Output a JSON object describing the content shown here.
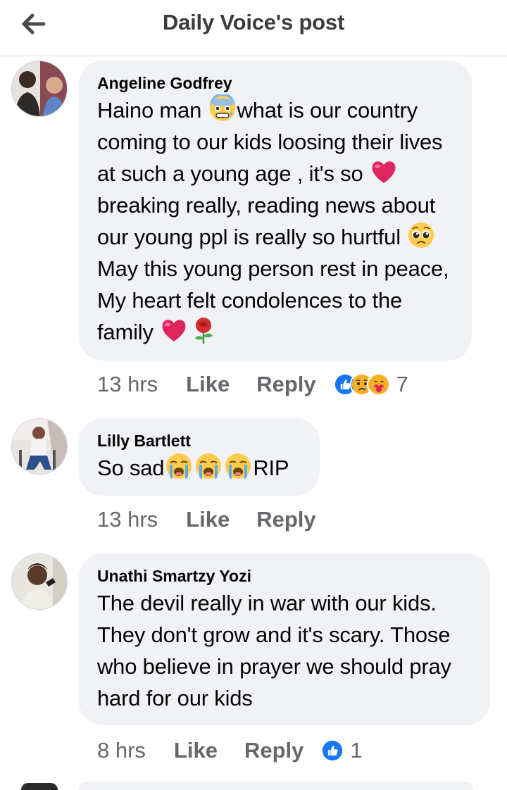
{
  "header": {
    "title": "Daily Voice's post"
  },
  "comments": [
    {
      "author": "Angeline Godfrey",
      "text_parts": [
        "Haino man ",
        "what is our country coming to our kids loosing their lives at such a young age , it's so ",
        " breaking really, reading news about our young ppl is really so hurtful ",
        "May this young person rest in peace, My heart felt condolences to the family "
      ],
      "emojis": [
        "anxious-face-emoji",
        "red-heart-emoji",
        "pleading-face-emoji",
        "red-heart-emoji",
        "rose-emoji"
      ],
      "time": "13 hrs",
      "like_label": "Like",
      "reply_label": "Reply",
      "reactions": [
        "like-reaction-icon",
        "sad-reaction-icon",
        "care-reaction-icon"
      ],
      "reaction_count": "7"
    },
    {
      "author": "Lilly Bartlett",
      "text_parts": [
        "So sad",
        "RIP"
      ],
      "emojis": [
        "loudly-crying-face-emoji",
        "loudly-crying-face-emoji",
        "loudly-crying-face-emoji"
      ],
      "time": "13 hrs",
      "like_label": "Like",
      "reply_label": "Reply"
    },
    {
      "author": "Unathi Smartzy Yozi",
      "text": "The devil really in war with our kids. They don't grow and it's scary. Those who believe in prayer we should pray hard for our kids",
      "time": "8 hrs",
      "like_label": "Like",
      "reply_label": "Reply",
      "reactions": [
        "like-reaction-icon"
      ],
      "reaction_count": "1"
    }
  ],
  "colors": {
    "bubble": "#f0f2f5",
    "meta_text": "#65676b",
    "like_blue": "#1877f2",
    "heart_red": "#e0245e"
  }
}
